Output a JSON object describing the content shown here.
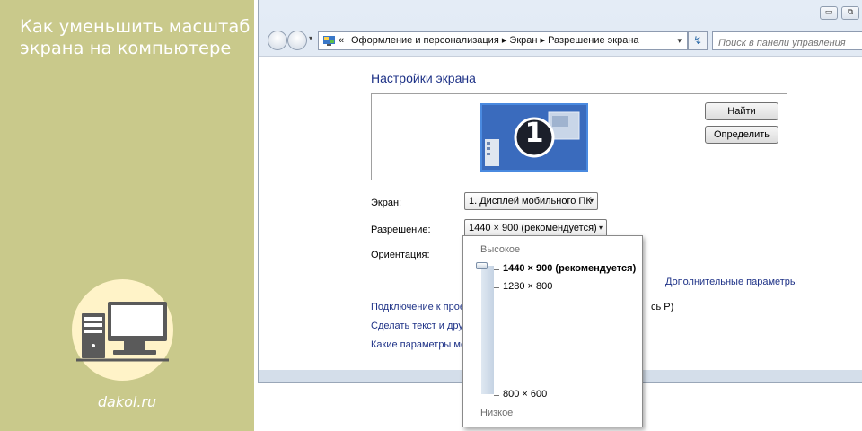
{
  "banner": {
    "title_line1": "Как уменьшить масштаб",
    "title_line2": "экрана на компьютере",
    "site": "dakol.ru",
    "circle_color": "#fff3c8",
    "background_color": "#c9c98b",
    "icon": "computer-monitor-icon"
  },
  "window": {
    "caption_buttons": {
      "minimize": "▭",
      "restore": "⧉"
    },
    "nav": {
      "history_arrow": "▾",
      "address_prefix": "«",
      "breadcrumb": "Оформление и персонализация  ▸  Экран  ▸  Разрешение экрана",
      "dropdown_arrow": "▾",
      "refresh_symbol": "↯",
      "search_placeholder": "Поиск в панели управления"
    },
    "page_title": "Настройки экрана",
    "buttons": {
      "find": "Найти",
      "identify": "Определить"
    },
    "monitor_number": "1",
    "form": {
      "display_label": "Экран:",
      "display_value": "1. Дисплей мобильного ПК",
      "resolution_label": "Разрешение:",
      "resolution_value": "1440 × 900 (рекомендуется)",
      "orientation_label": "Ориентация:",
      "combo_arrow": "▾"
    },
    "links": {
      "advanced": "Дополнительные параметры",
      "connect": "Подключение к проек",
      "connect_tail": "сь P)",
      "text_size": "Сделать текст и другие",
      "which_params": "Какие параметры мон"
    },
    "resolution_dropdown": {
      "high_label": "Высокое",
      "low_label": "Низкое",
      "options": [
        "1440 × 900 (рекомендуется)",
        "1280 × 800",
        "800 × 600"
      ]
    },
    "accent_color": "#1e3287"
  }
}
